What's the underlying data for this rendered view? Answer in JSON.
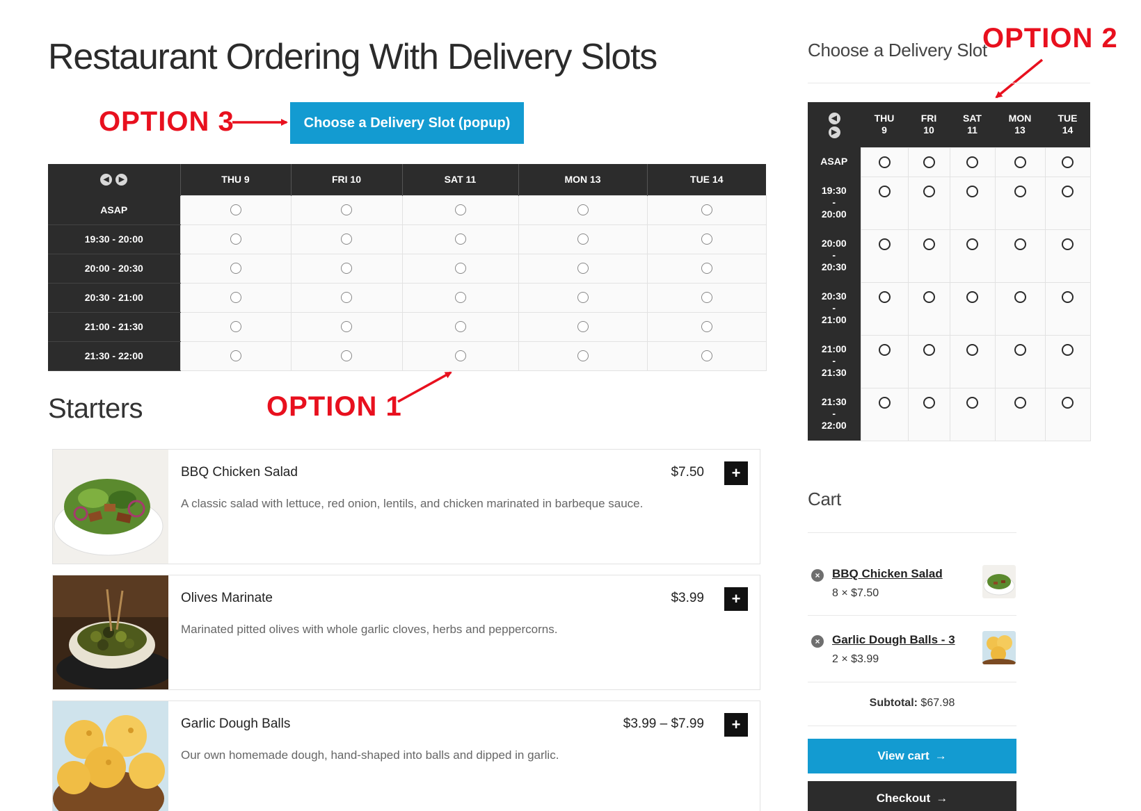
{
  "page": {
    "title": "Restaurant Ordering With Delivery Slots"
  },
  "annotations": {
    "option1": "OPTION 1",
    "option2": "OPTION 2",
    "option3": "OPTION 3"
  },
  "popup_button": {
    "label": "Choose a Delivery Slot (popup)"
  },
  "main_slots": {
    "days": [
      "THU 9",
      "FRI 10",
      "SAT 11",
      "MON 13",
      "TUE 14"
    ],
    "rows": [
      "ASAP",
      "19:30 - 20:00",
      "20:00 - 20:30",
      "20:30 - 21:00",
      "21:00 - 21:30",
      "21:30 - 22:00"
    ]
  },
  "sidebar_slots": {
    "heading": "Choose a Delivery Slot",
    "days": [
      {
        "dow": "THU",
        "date": "9"
      },
      {
        "dow": "FRI",
        "date": "10"
      },
      {
        "dow": "SAT",
        "date": "11"
      },
      {
        "dow": "MON",
        "date": "13"
      },
      {
        "dow": "TUE",
        "date": "14"
      }
    ],
    "rows": [
      {
        "from": "ASAP",
        "sep": "",
        "to": ""
      },
      {
        "from": "19:30",
        "sep": "-",
        "to": "20:00"
      },
      {
        "from": "20:00",
        "sep": "-",
        "to": "20:30"
      },
      {
        "from": "20:30",
        "sep": "-",
        "to": "21:00"
      },
      {
        "from": "21:00",
        "sep": "-",
        "to": "21:30"
      },
      {
        "from": "21:30",
        "sep": "-",
        "to": "22:00"
      }
    ]
  },
  "menu": {
    "section_title": "Starters",
    "products": [
      {
        "name": "BBQ Chicken Salad",
        "price": "$7.50",
        "description": "A classic salad with lettuce, red onion, lentils, and chicken marinated in barbeque sauce.",
        "add_label": "+"
      },
      {
        "name": "Olives Marinate",
        "price": "$3.99",
        "description": "Marinated pitted olives with whole garlic cloves, herbs and peppercorns.",
        "add_label": "+"
      },
      {
        "name": "Garlic Dough Balls",
        "price": "$3.99 – $7.99",
        "description": "Our own homemade dough, hand-shaped into balls and dipped in garlic.",
        "add_label": "+"
      }
    ]
  },
  "cart": {
    "heading": "Cart",
    "items": [
      {
        "name": "BBQ Chicken Salad",
        "qty": "8 × $7.50",
        "remove": "×"
      },
      {
        "name": "Garlic Dough Balls - 3",
        "qty": "2 × $3.99",
        "remove": "×"
      }
    ],
    "subtotal_label": "Subtotal:",
    "subtotal_value": "$67.98",
    "view_cart_label": "View cart",
    "checkout_label": "Checkout",
    "arrow": "→"
  },
  "colors": {
    "accent": "#139bd1",
    "dark": "#2c2c2c",
    "annotation": "#e8101e"
  },
  "icons": {
    "prev": "chevron-left-icon",
    "next": "chevron-right-icon",
    "remove": "remove-icon",
    "add": "plus-icon",
    "arrow": "arrow-right-icon"
  }
}
